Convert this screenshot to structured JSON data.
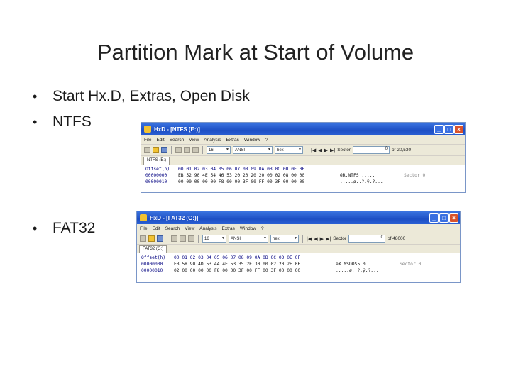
{
  "slide": {
    "title": "Partition Mark at Start of Volume",
    "bullets": [
      {
        "marker": "•",
        "text": "Start Hx.D, Extras, Open Disk"
      },
      {
        "marker": "•",
        "text": "NTFS"
      },
      {
        "marker": "•",
        "text": "FAT32"
      }
    ]
  },
  "ntfs_window": {
    "title": "HxD - [NTFS (E:)]",
    "menu": [
      "File",
      "Edit",
      "Search",
      "View",
      "Analysis",
      "Extras",
      "Window",
      "?"
    ],
    "toolbar": {
      "bytes_per_row": "16",
      "charset": "ANSI",
      "offset_base": "hex",
      "sector_label": "Sector",
      "sector_value": "0",
      "sector_total": "of 20,530"
    },
    "tab": "NTFS (E:)",
    "rows": [
      {
        "offset": "Offset(h)",
        "bytes": "00 01 02 03 04 05 06 07 08 09 0A 0B 0C 0D 0E 0F",
        "ascii": "",
        "side": ""
      },
      {
        "offset": "00000000",
        "bytes": "EB 52 90 4E 54 46 53 20 20 20 20 00 02 08 00 00",
        "ascii": "ëR.NTFS     .....",
        "side": "Sector 0"
      },
      {
        "offset": "00000010",
        "bytes": "00 00 00 00 00 F8 00 00 3F 00 FF 00 3F 00 00 00",
        "ascii": ".....ø..?.ÿ.?...",
        "side": ""
      }
    ]
  },
  "fat32_window": {
    "title": "HxD - [FAT32 (G:)]",
    "menu": [
      "File",
      "Edit",
      "Search",
      "View",
      "Analysis",
      "Extras",
      "Window",
      "?"
    ],
    "toolbar": {
      "bytes_per_row": "16",
      "charset": "ANSI",
      "offset_base": "hex",
      "sector_label": "Sector",
      "sector_value": "0",
      "sector_total": "of 48000"
    },
    "tab": "FAT32 (G:)",
    "rows": [
      {
        "offset": "Offset(h)",
        "bytes": "00 01 02 03 04 05 06 07 08 09 0A 0B 0C 0D 0E 0F",
        "ascii": "",
        "side": ""
      },
      {
        "offset": "00000000",
        "bytes": "EB 58 90 4D 53 44 4F 53 35 2E 30 00 02 20 2E 0E",
        "ascii": "ëX.MSDOS5.0... .",
        "side": "Sector 0"
      },
      {
        "offset": "00000010",
        "bytes": "02 00 00 00 00 F8 00 00 3F 00 FF 00 3F 00 00 00",
        "ascii": ".....ø..?.ÿ.?...",
        "side": ""
      }
    ]
  }
}
